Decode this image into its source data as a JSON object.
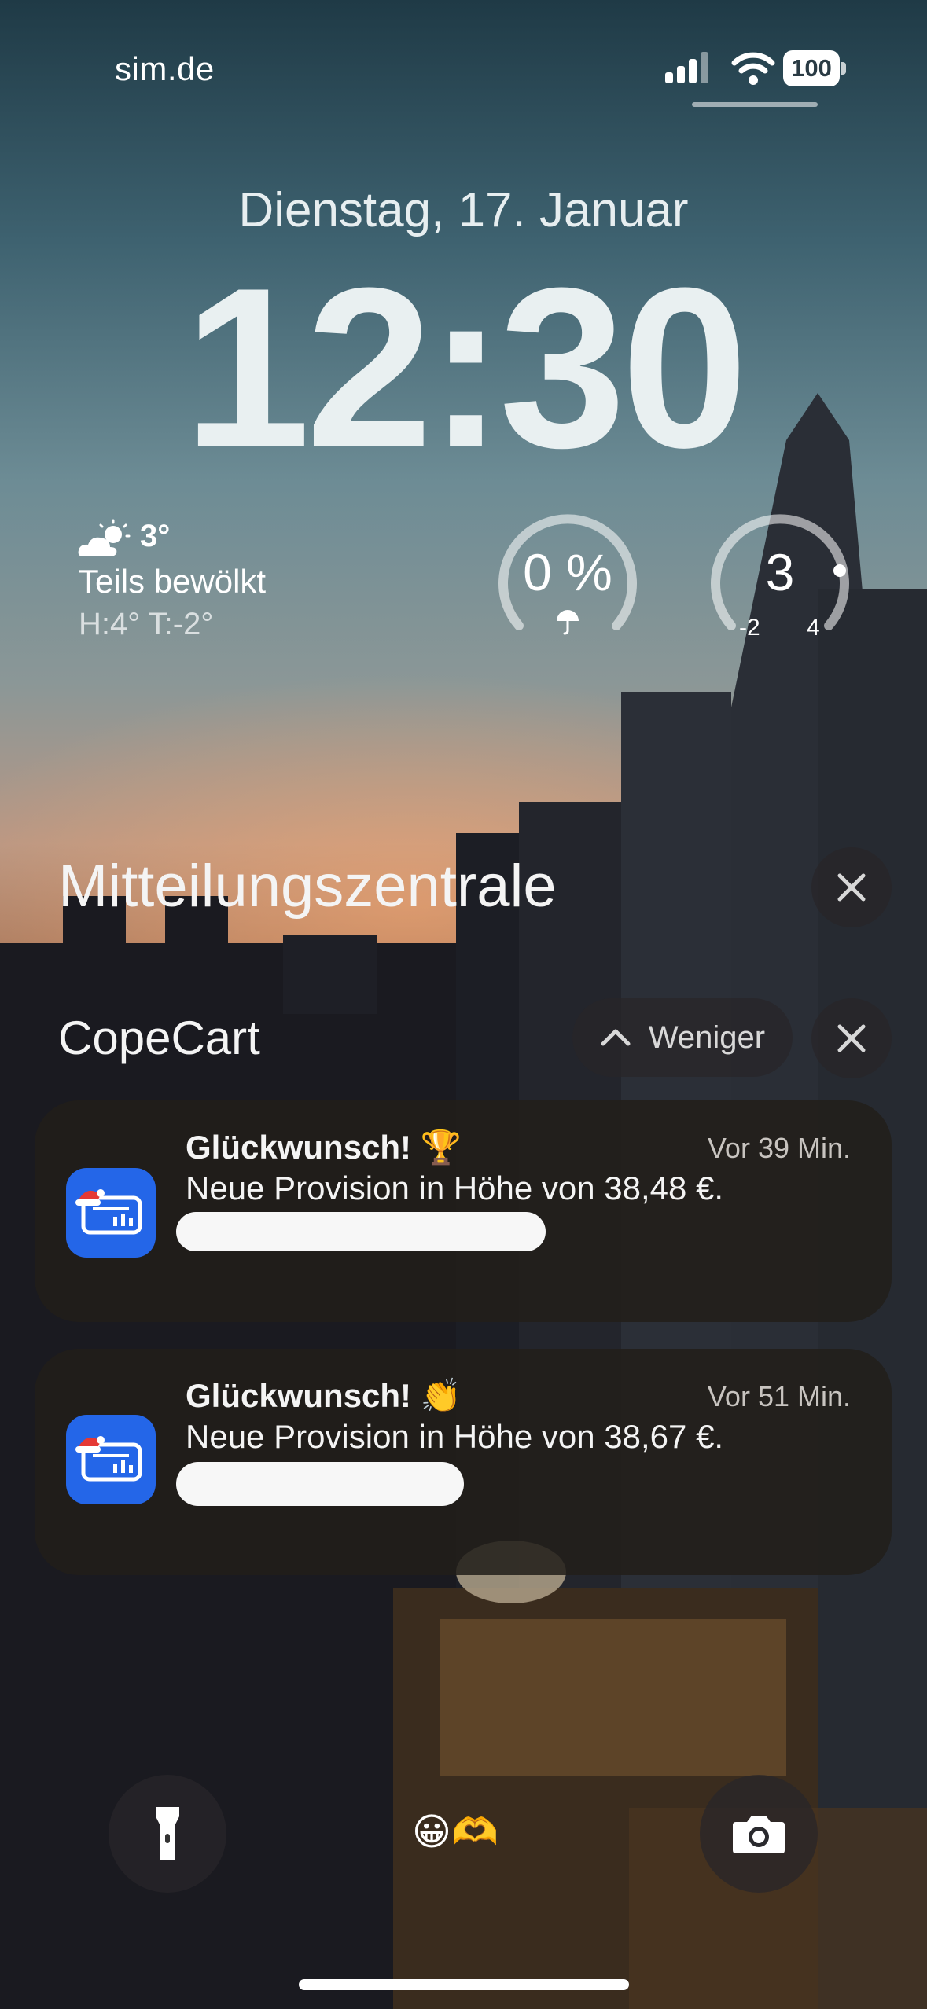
{
  "status_bar": {
    "carrier": "sim.de",
    "battery": "100",
    "signal_icon": "cellular-signal-icon",
    "wifi_icon": "wifi-icon"
  },
  "lockscreen": {
    "date": "Dienstag, 17. Januar",
    "time": "12:30"
  },
  "widgets": {
    "weather": {
      "icon": "partly-cloudy-icon",
      "temperature": "3°",
      "condition": "Teils bewölkt",
      "high_low": "H:4° T:-2°"
    },
    "precipitation": {
      "value": "0 %",
      "icon": "umbrella-icon",
      "level": 0
    },
    "temperature_gauge": {
      "value": "3",
      "min": "-2",
      "max": "4"
    }
  },
  "notification_center": {
    "title": "Mitteilungszentrale",
    "close_icon": "close-icon",
    "group": {
      "app_name": "CopeCart",
      "collapse_label": "Weniger",
      "collapse_icon": "chevron-up-icon"
    },
    "notifications": [
      {
        "title": "Glückwunsch! 🏆",
        "time": "Vor 39 Min.",
        "body": "Neue Provision in Höhe von 38,48 €.",
        "app_icon": "copecart-app-icon"
      },
      {
        "title": "Glückwunsch! 👏",
        "time": "Vor 51 Min.",
        "body": "Neue Provision in Höhe von 38,67 €.",
        "app_icon": "copecart-app-icon"
      }
    ]
  },
  "bottom_bar": {
    "flashlight_icon": "flashlight-icon",
    "camera_icon": "camera-icon",
    "emoji": "😀🫶"
  },
  "colors": {
    "app_icon_blue": "#2466e8",
    "card_background": "#221e1a"
  }
}
